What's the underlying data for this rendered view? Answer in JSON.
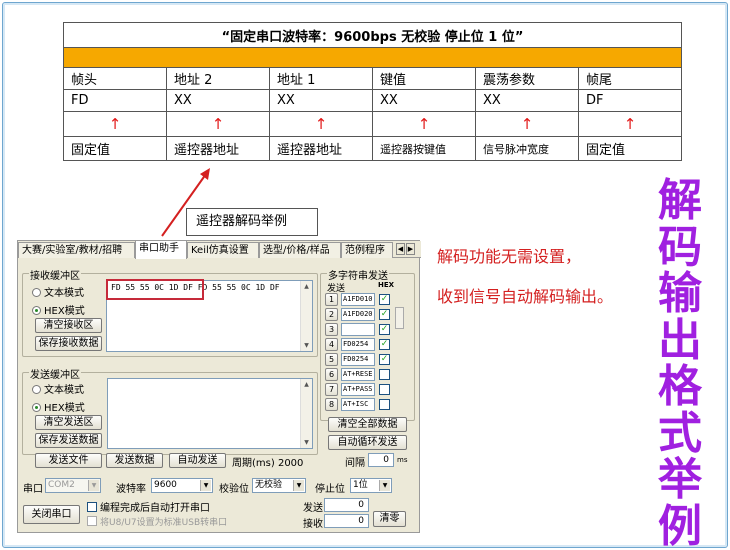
{
  "protocol": {
    "title": "“固定串口波特率：9600bps    无校验    停止位 1 位”",
    "headers": [
      "帧头",
      "地址 2",
      "地址 1",
      "键值",
      "震荡参数",
      "帧尾"
    ],
    "values": [
      "FD",
      "XX",
      "XX",
      "XX",
      "XX",
      "DF"
    ],
    "arrow": "↑",
    "descriptions": [
      "固定值",
      "遥控器地址",
      "遥控器地址",
      "遥控器按键值",
      "信号脉冲宽度",
      "固定值"
    ],
    "accent_color": "#f6a800"
  },
  "callout": "遥控器解码举例",
  "notes": [
    "解码功能无需设置，",
    "收到信号自动解码输出。"
  ],
  "vertical_title": [
    "解",
    "码",
    "输",
    "出",
    "格",
    "式",
    "举",
    "例"
  ],
  "app": {
    "tabs": [
      "大赛/实验室/教材/招聘",
      "串口助手",
      "Keil仿真设置",
      "选型/价格/样品",
      "范例程序"
    ],
    "active_tab": "串口助手",
    "recv": {
      "label": "接收缓冲区",
      "text_mode": "文本模式",
      "hex_mode": "HEX模式",
      "selected": "HEX模式",
      "clear": "清空接收区",
      "save": "保存接收数据",
      "data": "FD 55 55 0C 1D DF FD 55 55 0C 1D DF"
    },
    "send": {
      "label": "发送缓冲区",
      "text_mode": "文本模式",
      "hex_mode": "HEX模式",
      "selected": "HEX模式",
      "clear": "清空发送区",
      "save": "保存发送数据",
      "send_file": "发送文件",
      "send_data": "发送数据",
      "auto_send": "自动发送",
      "period_label": "周期(ms)",
      "period_value": "2000"
    },
    "multi": {
      "label": "多字符串发送",
      "col_send": "发送",
      "col_hex": "HEX",
      "rows": [
        {
          "num": "1",
          "text": "A1FD010",
          "hex": "✓"
        },
        {
          "num": "2",
          "text": "A1FD020",
          "hex": "✓"
        },
        {
          "num": "3",
          "text": "",
          "hex": "✓"
        },
        {
          "num": "4",
          "text": "FD0254",
          "hex": "✓"
        },
        {
          "num": "5",
          "text": "FD0254",
          "hex": "✓"
        },
        {
          "num": "6",
          "text": "AT+RESE",
          "hex": ""
        },
        {
          "num": "7",
          "text": "AT+PASS",
          "hex": ""
        },
        {
          "num": "8",
          "text": "AT+ISC",
          "hex": ""
        }
      ],
      "clear_all": "清空全部数据",
      "auto_loop": "自动循环发送",
      "interval_label": "间隔",
      "interval_value": "0",
      "interval_unit": "ms"
    },
    "bottom": {
      "port_label": "串口",
      "port_value": "COM2",
      "baud_label": "波特率",
      "baud_value": "9600",
      "parity_label": "校验位",
      "parity_value": "无校验",
      "stop_label": "停止位",
      "stop_value": "1位",
      "close_port": "关闭串口",
      "auto_open": "编程完成后自动打开串口",
      "usb_setting": "将U8/U7设置为标准USB转串口",
      "sent_label": "发送",
      "sent_value": "0",
      "recv_label": "接收",
      "recv_value": "0",
      "clear_count": "清零"
    }
  }
}
